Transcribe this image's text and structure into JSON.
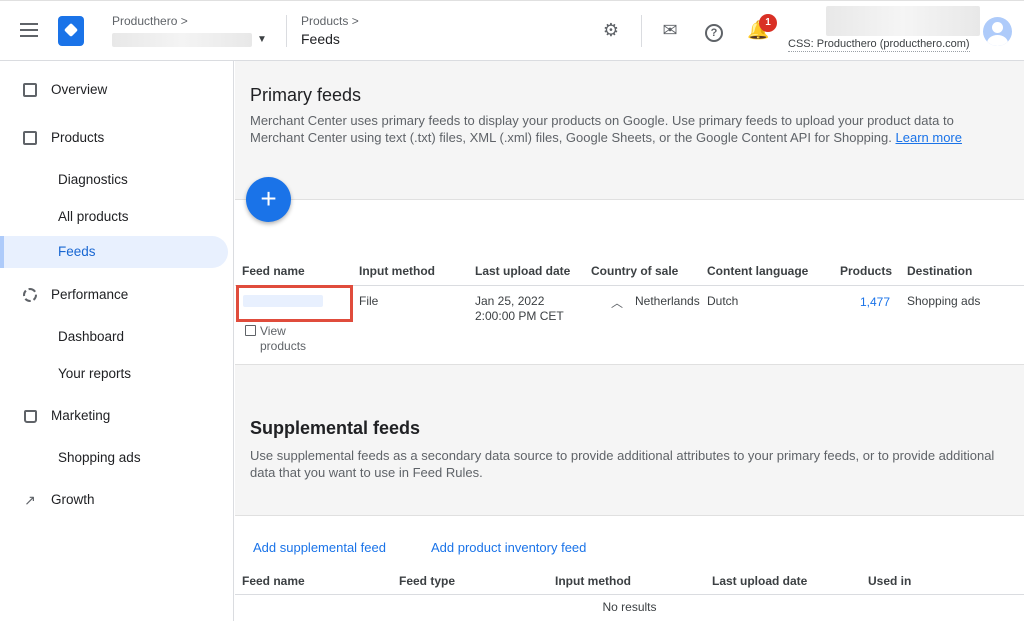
{
  "header": {
    "account_label": "Producthero",
    "crumb_parent": "Products",
    "crumb_title": "Feeds",
    "notification_count": "1",
    "css_label": "CSS: Producthero (producthero.com)"
  },
  "sidebar": {
    "items": [
      {
        "label": "Overview"
      },
      {
        "label": "Products"
      },
      {
        "label": "Diagnostics"
      },
      {
        "label": "All products"
      },
      {
        "label": "Feeds"
      },
      {
        "label": "Performance"
      },
      {
        "label": "Dashboard"
      },
      {
        "label": "Your reports"
      },
      {
        "label": "Marketing"
      },
      {
        "label": "Shopping ads"
      },
      {
        "label": "Growth"
      }
    ]
  },
  "primary": {
    "title": "Primary feeds",
    "description": "Merchant Center uses primary feeds to display your products on Google. Use primary feeds to upload your product data to Merchant Center using text (.txt) files, XML (.xml) files, Google Sheets, or the Google Content API for Shopping.",
    "learn_more": "Learn more",
    "add_label": "+",
    "columns": [
      "Feed name",
      "Input method",
      "Last upload date",
      "Country of sale",
      "Content language",
      "Products",
      "Destination"
    ],
    "row": {
      "view_products": "View products",
      "input_method": "File",
      "upload_date": "Jan 25, 2022",
      "upload_time": "2:00:00 PM CET",
      "country": "Netherlands",
      "language": "Dutch",
      "products": "1,477",
      "destination": "Shopping ads"
    }
  },
  "supplemental": {
    "title": "Supplemental feeds",
    "description": "Use supplemental feeds as a secondary data source to provide additional attributes to your primary feeds, or to provide additional data that you want to use in Feed Rules.",
    "add_supplemental": "Add supplemental feed",
    "add_inventory": "Add product inventory feed",
    "columns": [
      "Feed name",
      "Feed type",
      "Input method",
      "Last upload date",
      "Used in"
    ],
    "empty": "No results"
  },
  "colors": {
    "accent": "#1a73e8",
    "active_bg": "#e8f0fe",
    "highlight": "#e04c3c",
    "badge": "#d93025"
  }
}
